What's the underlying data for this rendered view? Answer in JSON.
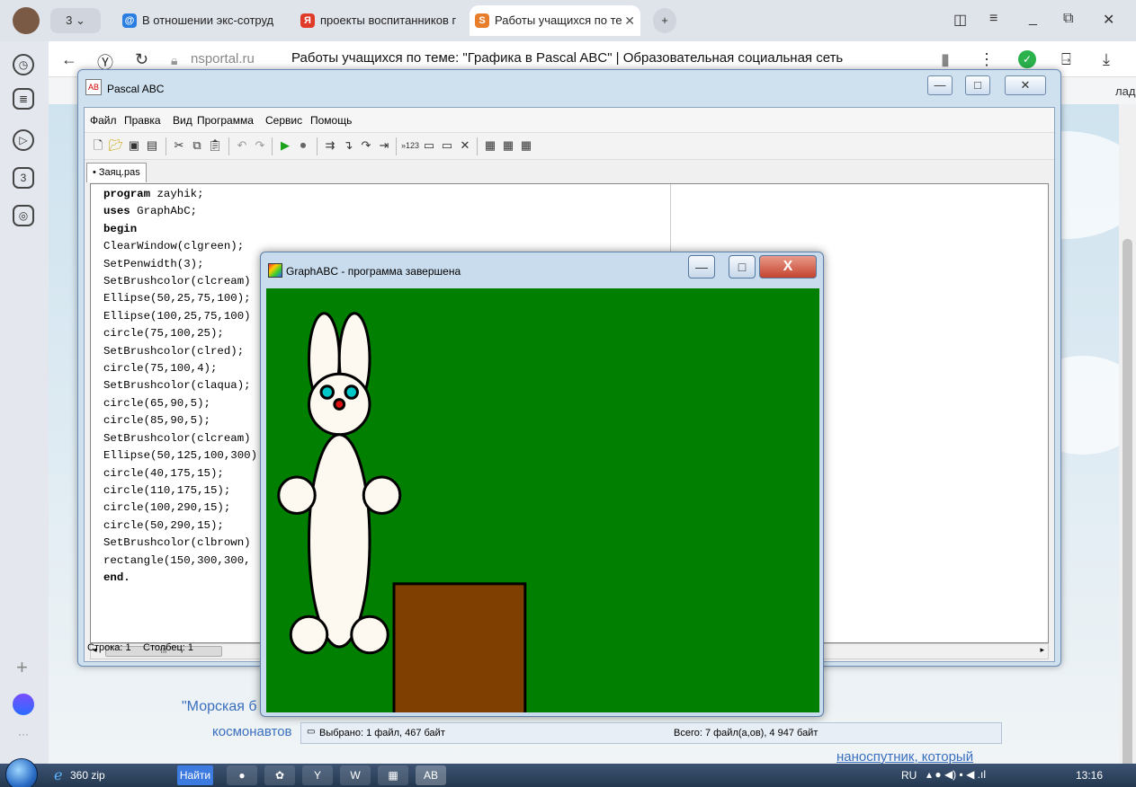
{
  "browser": {
    "tabs": [
      {
        "label": "В отношении экс-сотруд",
        "icon": "@"
      },
      {
        "label": "проекты воспитанников г",
        "icon": "Я"
      },
      {
        "label": "Работы учащихся по те",
        "icon": "S"
      }
    ],
    "tab_count_badge": "3",
    "new_tab": "+",
    "address_domain": "nsportal.ru",
    "address_title": "Работы учащихся по теме: \"Графика в Pascal ABC\" | Образовательная социальная сеть",
    "bookmarks_label": "ладки ⌄"
  },
  "pascal_window": {
    "title": "Pascal ABC",
    "icon_text": "AB",
    "menu": [
      "Файл",
      "Правка",
      "Вид",
      "Программа",
      "Сервис",
      "Помощь"
    ],
    "file_tab": "• Заяц.pas",
    "status_row": "Строка: 1",
    "status_col": "Столбец: 1",
    "hscroll_grip": "III",
    "code_lines": [
      {
        "kw": "program",
        "rest": " zayhik;"
      },
      {
        "kw": "uses",
        "rest": " GraphAbC;"
      },
      {
        "kw": "begin",
        "rest": ""
      },
      {
        "kw": "",
        "rest": "ClearWindow(clgreen);"
      },
      {
        "kw": "",
        "rest": "SetPenwidth(3);"
      },
      {
        "kw": "",
        "rest": "SetBrushcolor(clcream)"
      },
      {
        "kw": "",
        "rest": "Ellipse(50,25,75,100);"
      },
      {
        "kw": "",
        "rest": "Ellipse(100,25,75,100)"
      },
      {
        "kw": "",
        "rest": "circle(75,100,25);"
      },
      {
        "kw": "",
        "rest": "SetBrushcolor(clred);"
      },
      {
        "kw": "",
        "rest": "circle(75,100,4);"
      },
      {
        "kw": "",
        "rest": "SetBrushcolor(claqua);"
      },
      {
        "kw": "",
        "rest": "circle(65,90,5);"
      },
      {
        "kw": "",
        "rest": "circle(85,90,5);"
      },
      {
        "kw": "",
        "rest": "SetBrushcolor(clcream)"
      },
      {
        "kw": "",
        "rest": "Ellipse(50,125,100,300)"
      },
      {
        "kw": "",
        "rest": "circle(40,175,15);"
      },
      {
        "kw": "",
        "rest": "circle(110,175,15);"
      },
      {
        "kw": "",
        "rest": "circle(100,290,15);"
      },
      {
        "kw": "",
        "rest": "circle(50,290,15);"
      },
      {
        "kw": "",
        "rest": "SetBrushcolor(clbrown)"
      },
      {
        "kw": "",
        "rest": "rectangle(150,300,300,"
      },
      {
        "kw": "end.",
        "rest": ""
      }
    ]
  },
  "graph_window": {
    "title": "GraphABC - программа завершена",
    "bg_color": "#007f00",
    "cream": "#fdf8f0",
    "brown": "#7f3f00",
    "eye": "#00c8c8",
    "nose": "#d11"
  },
  "explorer_strip": {
    "selected": "Выбрано: 1 файл, 467 байт",
    "total": "Всего: 7 файл(а,ов), 4 947 байт"
  },
  "page": {
    "text1": "\"Морская б",
    "text2": "космонавтов",
    "text3": "наноспутник, который"
  },
  "taskbar": {
    "zip": "360 zip",
    "find": "Найти",
    "lang": "RU",
    "time": "13:16"
  }
}
